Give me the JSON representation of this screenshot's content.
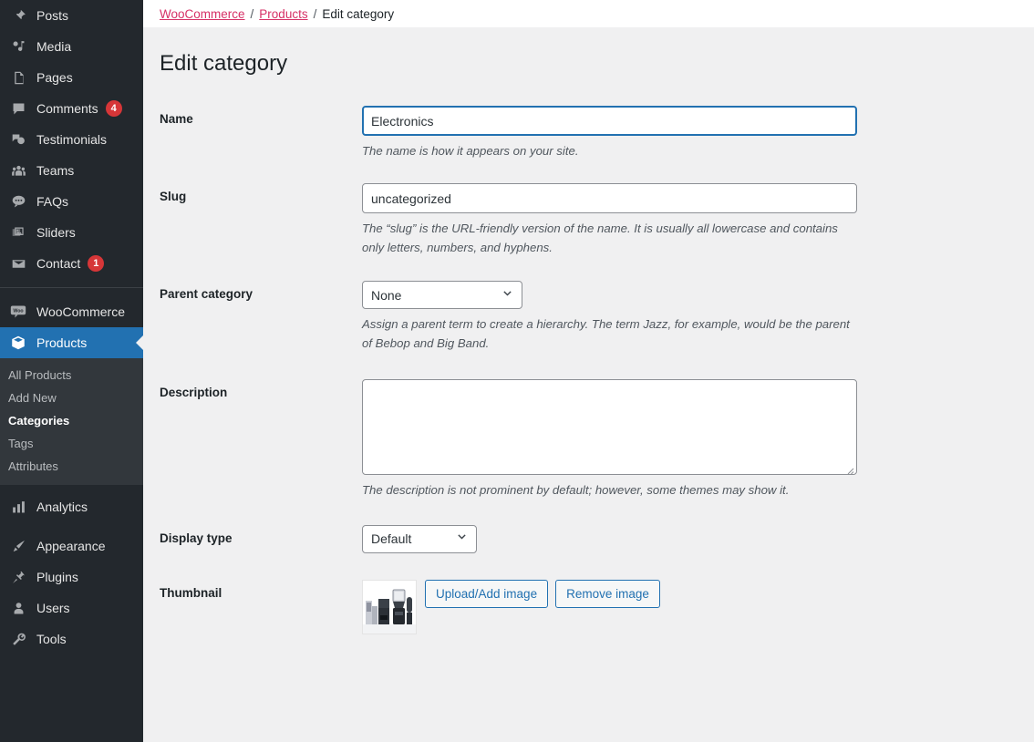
{
  "sidebar": {
    "items": [
      {
        "label": "Posts",
        "icon": "pin-icon"
      },
      {
        "label": "Media",
        "icon": "media-icon"
      },
      {
        "label": "Pages",
        "icon": "pages-icon"
      },
      {
        "label": "Comments",
        "icon": "comment-icon",
        "badge": "4"
      },
      {
        "label": "Testimonials",
        "icon": "testimonials-icon"
      },
      {
        "label": "Teams",
        "icon": "teams-icon"
      },
      {
        "label": "FAQs",
        "icon": "faq-icon"
      },
      {
        "label": "Sliders",
        "icon": "sliders-icon"
      },
      {
        "label": "Contact",
        "icon": "envelope-icon",
        "badge": "1"
      },
      {
        "label": "WooCommerce",
        "icon": "woocommerce-icon"
      },
      {
        "label": "Products",
        "icon": "products-icon",
        "active": true
      }
    ],
    "submenu": [
      {
        "label": "All Products"
      },
      {
        "label": "Add New"
      },
      {
        "label": "Categories",
        "current": true
      },
      {
        "label": "Tags"
      },
      {
        "label": "Attributes"
      }
    ],
    "items_bottom": [
      {
        "label": "Analytics",
        "icon": "analytics-icon"
      },
      {
        "label": "Appearance",
        "icon": "brush-icon"
      },
      {
        "label": "Plugins",
        "icon": "plug-icon"
      },
      {
        "label": "Users",
        "icon": "user-icon"
      },
      {
        "label": "Tools",
        "icon": "wrench-icon"
      }
    ],
    "colors": {
      "background": "#23282d",
      "submenu_background": "#32373c",
      "active": "#2271b1",
      "badge": "#d63638"
    }
  },
  "breadcrumb": {
    "root": "WooCommerce",
    "sep1": "/",
    "section": "Products",
    "sep2": "/",
    "current": "Edit category"
  },
  "page": {
    "title": "Edit category"
  },
  "form": {
    "name": {
      "label": "Name",
      "value": "Electronics",
      "help": "The name is how it appears on your site."
    },
    "slug": {
      "label": "Slug",
      "value": "uncategorized",
      "help": "The “slug” is the URL-friendly version of the name. It is usually all lowercase and contains only letters, numbers, and hyphens."
    },
    "parent": {
      "label": "Parent category",
      "selected": "None",
      "options": [
        "None"
      ],
      "help": "Assign a parent term to create a hierarchy. The term Jazz, for example, would be the parent of Bebop and Big Band."
    },
    "description": {
      "label": "Description",
      "value": "",
      "help": "The description is not prominent by default; however, some themes may show it."
    },
    "display_type": {
      "label": "Display type",
      "selected": "Default",
      "options": [
        "Default"
      ]
    },
    "thumbnail": {
      "label": "Thumbnail",
      "image_alt": "kitchen-appliances-product-photo",
      "upload_button": "Upload/Add image",
      "remove_button": "Remove image"
    }
  }
}
